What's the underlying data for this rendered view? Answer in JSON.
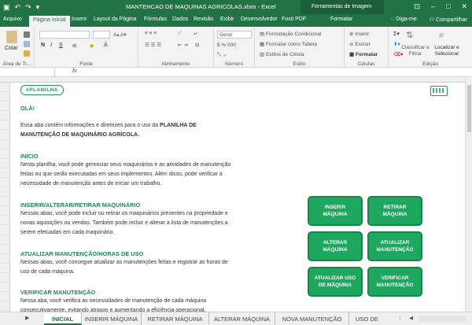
{
  "window": {
    "title": "MANTENCAO DE MAQUINAS AGRICOLAS.xlsm - Excel",
    "context_tab": "Ferramentas de Imagem",
    "context_subtab": "Formatar"
  },
  "ribbon": {
    "tabs": [
      "Arquivo",
      "Página Inicial",
      "Inserir",
      "Layout da Página",
      "Fórmulas",
      "Dados",
      "Revisão",
      "Exibir",
      "Desenvolvedor",
      "Foxit PDF"
    ],
    "help": "Diga-me.",
    "share": "Compartilhar",
    "groups": {
      "clipboard": "Área de Tr...",
      "font": "Fonte",
      "alignment": "Alinhamento",
      "number": "Número",
      "styles": "Estilo",
      "cells": "Células",
      "editing": "Edição"
    },
    "paste_label": "Colar",
    "number_format": "Geral",
    "style_items": [
      "Formatação Condicional",
      "Formatar como Tabela",
      "Estilos de Célula"
    ],
    "cell_items": [
      "Inserir",
      "Excluir",
      "Formatar"
    ],
    "edit_items": [
      "Classificar e Filtrar",
      "Localizar e Selecionar"
    ]
  },
  "content": {
    "badge": "#PLANILHA",
    "greeting": "OLÁ!",
    "intro_pre": "Essa aba contém informações e diretrizes para o uso da ",
    "intro_bold": "PLANILHA DE MANUTENÇÃO DE MAQUINÁRIO AGRÍCOLA.",
    "sections": [
      {
        "title": "INÍCIO",
        "text": "Nesta planilha, você pode gerenciar seus maquinários e as atividades de manutenção feitas ou que serão executadas em seus implementos. Além disso, pode verificar a necessidade de manutenção antes de iniciar um trabalho."
      },
      {
        "title": "INSERIR/ALTERAR/RETIRAR MAQUINÁRIO",
        "text": "Nessas abas, você pode incluir ou retirar os maquinários presentes na propriedade e novas aquisições ou vendas. Também pode incluir e alterar a lista de manutenções a serem efetuadas em cada maquinário."
      },
      {
        "title": "ATUALIZAR MANUTENÇÃO/HORAS DE USO",
        "text": "Nessas abas, você consegue atualizar as manutenções feitas e registrar as horas de uso de cada máquina."
      },
      {
        "title": "VERIFICAR MANUTENÇÃO",
        "text": "Nessa aba, você verifica as necessidades de manutenção de cada máquina consecutivamente, evitando atrasos e aumentando a eficiência operacional."
      }
    ],
    "buttons": [
      [
        "INSERIR",
        "MÁQUINA"
      ],
      [
        "RETIRAR",
        "MÁQUINA"
      ],
      [
        "ALTERAR",
        "MÁQUINA"
      ],
      [
        "ATUALIZAR",
        "MANUTENÇÃO"
      ],
      [
        "ATUALIZAR USO",
        "DE MÁQUINA"
      ],
      [
        "VERIFICAR",
        "MANUTENÇÃO"
      ]
    ]
  },
  "sheet_tabs": [
    "INICIAL",
    "INSERIR MÁQUINA",
    "RETIRAR MÁQUINA",
    "ALTERAR MÁQUINA",
    "NOVA MANUTENÇÃO",
    "USO DE"
  ],
  "colors": {
    "excel_green": "#217346",
    "accent_green": "#1ea85f",
    "heading_green": "#1e8a55"
  }
}
